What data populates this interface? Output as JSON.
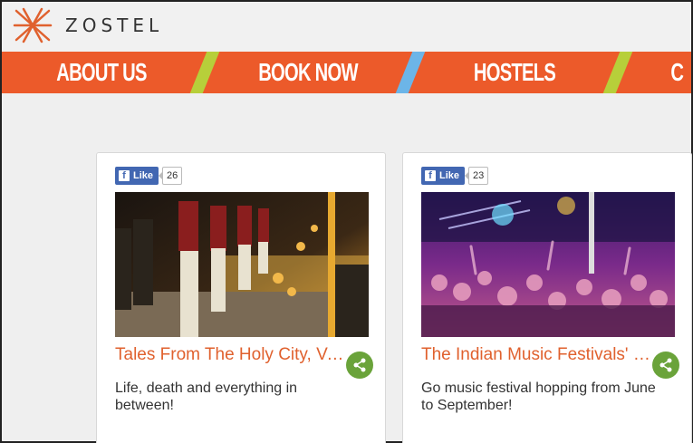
{
  "brand": {
    "name": "ZOSTEL"
  },
  "nav": {
    "items": [
      {
        "label": "ABOUT US"
      },
      {
        "label": "BOOK NOW"
      },
      {
        "label": "HOSTELS"
      },
      {
        "label": "C"
      }
    ],
    "stripe_colors": [
      "#b7cf3a",
      "#6cb5e8",
      "#b7cf3a"
    ]
  },
  "colors": {
    "accent": "#ec5a2a",
    "title": "#e0612e",
    "share": "#6aa33a",
    "facebook": "#4267b2"
  },
  "cards": [
    {
      "like_label": "Like",
      "like_count": "26",
      "title": "Tales From The Holy City, Varanasi",
      "description": "Life, death and everything in between!"
    },
    {
      "like_label": "Like",
      "like_count": "23",
      "title": "The Indian Music Festivals' Roundup",
      "description": "Go music festival hopping from June to September!"
    }
  ]
}
